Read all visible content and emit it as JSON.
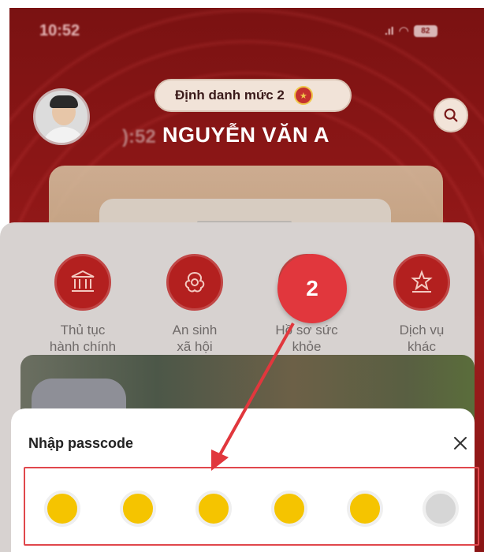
{
  "status_bar": {
    "time": "10:52",
    "signal": ".ıl",
    "battery": "82"
  },
  "header": {
    "badge_label": "Định danh mức 2",
    "name_prefix": "):52",
    "user_name": "NGUYỄN VĂN A"
  },
  "services": [
    {
      "label_line1": "Thủ tục",
      "label_line2": "hành chính",
      "icon": "government-building-icon"
    },
    {
      "label_line1": "An sinh",
      "label_line2": "xã hội",
      "icon": "social-welfare-icon"
    },
    {
      "label_line1": "Hồ sơ sức",
      "label_line2": "khỏe",
      "icon": "health-record-icon"
    },
    {
      "label_line1": "Dịch vụ",
      "label_line2": "khác",
      "icon": "other-services-icon"
    }
  ],
  "passcode_sheet": {
    "title": "Nhập passcode",
    "digits_total": 6,
    "digits_entered": 5
  },
  "annotation": {
    "step_number": "2"
  },
  "colors": {
    "header_red": "#8f1717",
    "service_icon_red": "#b3201f",
    "dot_filled": "#f5c400",
    "dot_empty": "#d6d6d6",
    "annotation_red": "#e1373d"
  }
}
